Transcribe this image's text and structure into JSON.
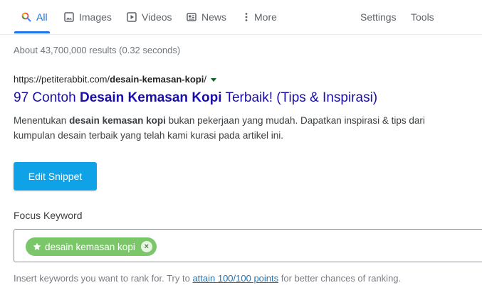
{
  "tabs": {
    "all": "All",
    "images": "Images",
    "videos": "Videos",
    "news": "News",
    "more": "More",
    "settings": "Settings",
    "tools": "Tools"
  },
  "results": {
    "stats": "About 43,700,000 results (0.32 seconds)",
    "url_prefix": "https://petiterabbit.com/",
    "url_bold": "desain-kemasan-kopi",
    "url_suffix": "/",
    "title_pre": "97 Contoh ",
    "title_bold": "Desain Kemasan Kopi",
    "title_post": " Terbaik! (Tips & Inspirasi)",
    "desc_pre": "Menentukan ",
    "desc_bold": "desain kemasan kopi",
    "desc_post": " bukan pekerjaan yang mudah. Dapatkan inspirasi & tips dari kumpulan desain terbaik yang telah kami kurasi pada artikel ini."
  },
  "editor": {
    "edit_snippet": "Edit Snippet",
    "focus_label": "Focus Keyword",
    "keyword": "desain kemasan kopi",
    "remove_glyph": "×",
    "hint_pre": "Insert keywords you want to rank for. Try to ",
    "hint_link": "attain 100/100 points",
    "hint_post": " for better chances of ranking."
  },
  "colors": {
    "accent": "#1a73e8",
    "link_title": "#1a0dab",
    "button": "#10a2e6",
    "chip": "#7cc66a"
  },
  "icons": [
    "search-icon",
    "image-icon",
    "play-icon",
    "news-icon",
    "more-dots-icon",
    "star-icon",
    "remove-icon",
    "dropdown-caret-icon"
  ]
}
